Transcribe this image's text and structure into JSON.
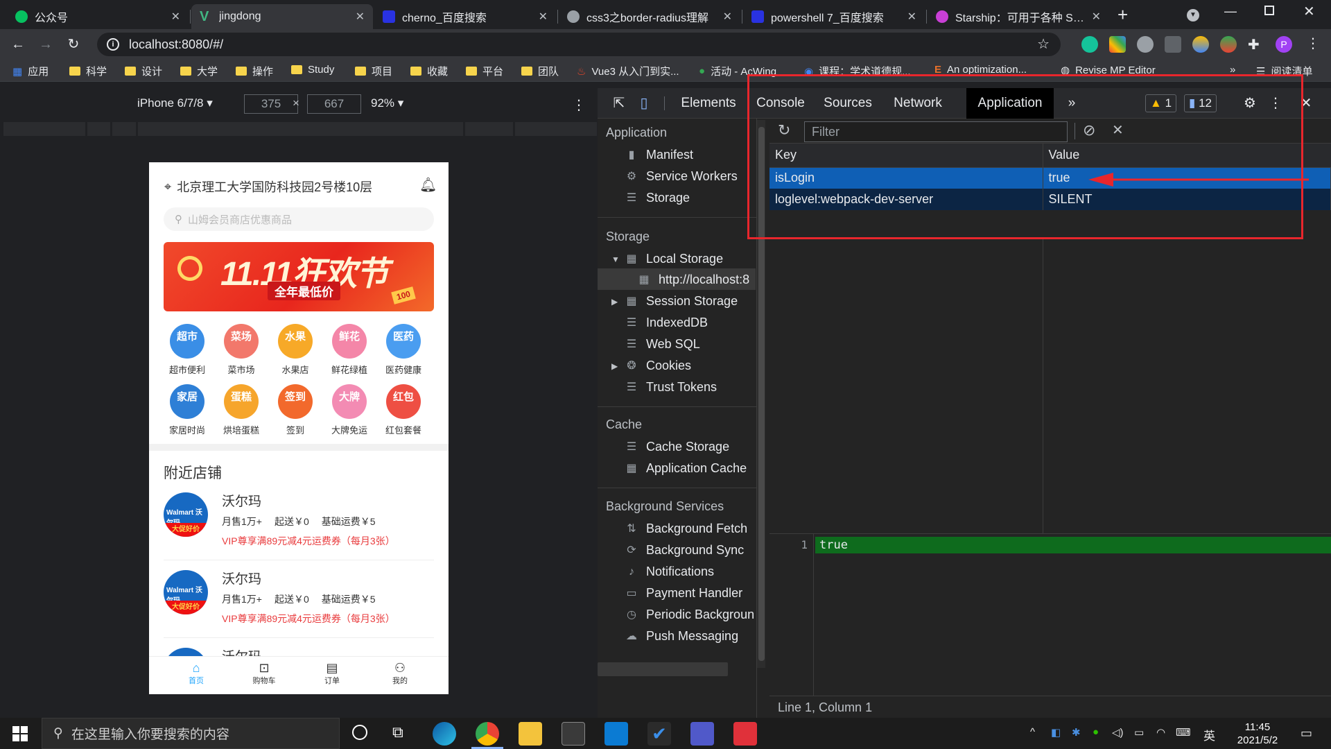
{
  "browser": {
    "tabs": [
      {
        "title": "公众号",
        "favicon_color": "#07c160",
        "active": false
      },
      {
        "title": "jingdong",
        "favicon_color": "#41b883",
        "active": true
      },
      {
        "title": "cherno_百度搜索",
        "favicon_color": "#2932e1",
        "active": false
      },
      {
        "title": "css3之border-radius理解",
        "favicon_color": "#9aa0a6",
        "active": false
      },
      {
        "title": "powershell 7_百度搜索",
        "favicon_color": "#2932e1",
        "active": false
      },
      {
        "title": "Starship：可用于各种 Shel",
        "favicon_color": "#c93fd6",
        "active": false
      }
    ],
    "url": "localhost:8080/#/",
    "bookmarks": [
      "应用",
      "科学",
      "设计",
      "大学",
      "操作",
      "Study",
      "项目",
      "收藏",
      "平台",
      "团队",
      "Vue3 从入门到实...",
      "活动 - AcWing",
      "课程：学术道德规...",
      "An optimization...",
      "Revise MP Editor",
      "阅读清单"
    ]
  },
  "device_toolbar": {
    "device": "iPhone 6/7/8",
    "width": "375",
    "height": "667",
    "times": "×",
    "zoom": "92%"
  },
  "app": {
    "location": "北京理工大学国防科技园2号楼10层",
    "search_placeholder": "山姆会员商店优惠商品",
    "banner_title": "11.11狂欢节",
    "banner_sub": "全年最低价",
    "banner_tag": "100",
    "categories": [
      {
        "icon_text": "超市",
        "label": "超市便利",
        "color": "#3a8ee6"
      },
      {
        "icon_text": "菜场",
        "label": "菜市场",
        "color": "#f2786b"
      },
      {
        "icon_text": "水果",
        "label": "水果店",
        "color": "#f7a928"
      },
      {
        "icon_text": "鲜花",
        "label": "鲜花绿植",
        "color": "#f486a8"
      },
      {
        "icon_text": "医药",
        "label": "医药健康",
        "color": "#4a9df0"
      },
      {
        "icon_text": "家居",
        "label": "家居时尚",
        "color": "#2e7fd6"
      },
      {
        "icon_text": "蛋糕",
        "label": "烘培蛋糕",
        "color": "#f6a52b"
      },
      {
        "icon_text": "签到",
        "label": "签到",
        "color": "#f2692c"
      },
      {
        "icon_text": "大牌",
        "label": "大牌免运",
        "color": "#f38bb3"
      },
      {
        "icon_text": "红包",
        "label": "红包套餐",
        "color": "#ee4f43"
      }
    ],
    "nearby_title": "附近店铺",
    "shops": [
      {
        "name": "沃尔玛",
        "sales": "月售1万+",
        "min": "起送￥0",
        "fee": "基础运费￥5",
        "promo": "VIP尊享满89元减4元运费券（每月3张）"
      },
      {
        "name": "沃尔玛",
        "sales": "月售1万+",
        "min": "起送￥0",
        "fee": "基础运费￥5",
        "promo": "VIP尊享满89元减4元运费券（每月3张）"
      },
      {
        "name": "沃尔玛",
        "sales": "",
        "min": "",
        "fee": "",
        "promo": ""
      }
    ],
    "logo_text": "Walmart 沃尔玛",
    "logo_ribbon": "大促好价",
    "tabbar": [
      {
        "label": "首页",
        "icon": "home-icon",
        "active": true
      },
      {
        "label": "购物车",
        "icon": "cart-icon",
        "active": false
      },
      {
        "label": "订单",
        "icon": "order-icon",
        "active": false
      },
      {
        "label": "我的",
        "icon": "user-icon",
        "active": false
      }
    ]
  },
  "devtools": {
    "tabs": [
      "Elements",
      "Console",
      "Sources",
      "Network",
      "Application"
    ],
    "selected_tab": "Application",
    "warnings": "1",
    "messages": "12",
    "sidebar": {
      "application_header": "Application",
      "application_items": [
        "Manifest",
        "Service Workers",
        "Storage"
      ],
      "storage_header": "Storage",
      "storage_items": [
        "Local Storage",
        "http://localhost:8",
        "Session Storage",
        "IndexedDB",
        "Web SQL",
        "Cookies",
        "Trust Tokens"
      ],
      "cache_header": "Cache",
      "cache_items": [
        "Cache Storage",
        "Application Cache"
      ],
      "bg_header": "Background Services",
      "bg_items": [
        "Background Fetch",
        "Background Sync",
        "Notifications",
        "Payment Handler",
        "Periodic Backgroun",
        "Push Messaging"
      ]
    },
    "filter_placeholder": "Filter",
    "table": {
      "headers": [
        "Key",
        "Value"
      ],
      "rows": [
        {
          "key": "isLogin",
          "value": "true"
        },
        {
          "key": "loglevel:webpack-dev-server",
          "value": "SILENT"
        }
      ]
    },
    "preview": {
      "line_number": "1",
      "code": "true"
    },
    "status": "Line 1, Column 1"
  },
  "taskbar": {
    "search_placeholder": "在这里输入你要搜索的内容",
    "ime": "英",
    "time": "11:45",
    "date": "2021/5/2"
  },
  "colors": {
    "accent_red": "#e8262c",
    "selected_row": "#0f5fb5",
    "code_highlight": "#0e6b1d"
  }
}
